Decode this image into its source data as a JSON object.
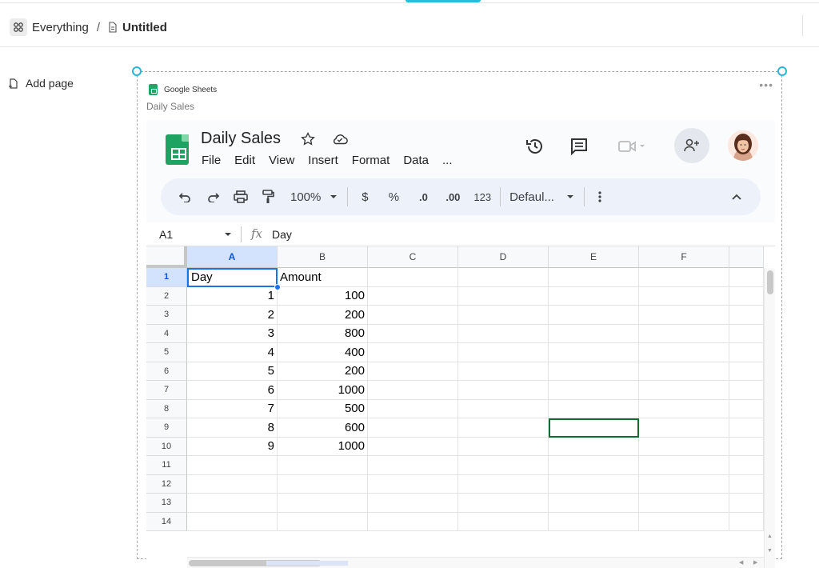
{
  "breadcrumb": {
    "root": "Everything",
    "separator": "/",
    "current": "Untitled"
  },
  "sidebar": {
    "add_page": "Add page"
  },
  "embed": {
    "source": "Google Sheets",
    "title": "Daily Sales",
    "more": "•••"
  },
  "sheet": {
    "title": "Daily Sales",
    "menu": [
      "File",
      "Edit",
      "View",
      "Insert",
      "Format",
      "Data",
      "..."
    ],
    "toolbar": {
      "zoom": "100%",
      "currency": "$",
      "percent": "%",
      "decrease_decimal": ".0",
      "increase_decimal": ".00",
      "number_format": "123",
      "font": "Defaul..."
    },
    "formula_bar": {
      "name_box": "A1",
      "fx": "fx",
      "value": "Day"
    },
    "columns": [
      "A",
      "B",
      "C",
      "D",
      "E",
      "F"
    ],
    "rows": [
      {
        "n": "1",
        "a": "Day",
        "b": "Amount"
      },
      {
        "n": "2",
        "a": "1",
        "b": "100"
      },
      {
        "n": "3",
        "a": "2",
        "b": "200"
      },
      {
        "n": "4",
        "a": "3",
        "b": "800"
      },
      {
        "n": "5",
        "a": "4",
        "b": "400"
      },
      {
        "n": "6",
        "a": "5",
        "b": "200"
      },
      {
        "n": "7",
        "a": "6",
        "b": "1000"
      },
      {
        "n": "8",
        "a": "7",
        "b": "500"
      },
      {
        "n": "9",
        "a": "8",
        "b": "600"
      },
      {
        "n": "10",
        "a": "9",
        "b": "1000"
      },
      {
        "n": "11",
        "a": "",
        "b": ""
      },
      {
        "n": "12",
        "a": "",
        "b": ""
      },
      {
        "n": "13",
        "a": "",
        "b": ""
      },
      {
        "n": "14",
        "a": "",
        "b": ""
      }
    ]
  },
  "colors": {
    "accent": "#25c0d8",
    "sheets_green": "#1ea362",
    "selection_blue": "#1a73e8",
    "highlight_green": "#146c2e"
  }
}
